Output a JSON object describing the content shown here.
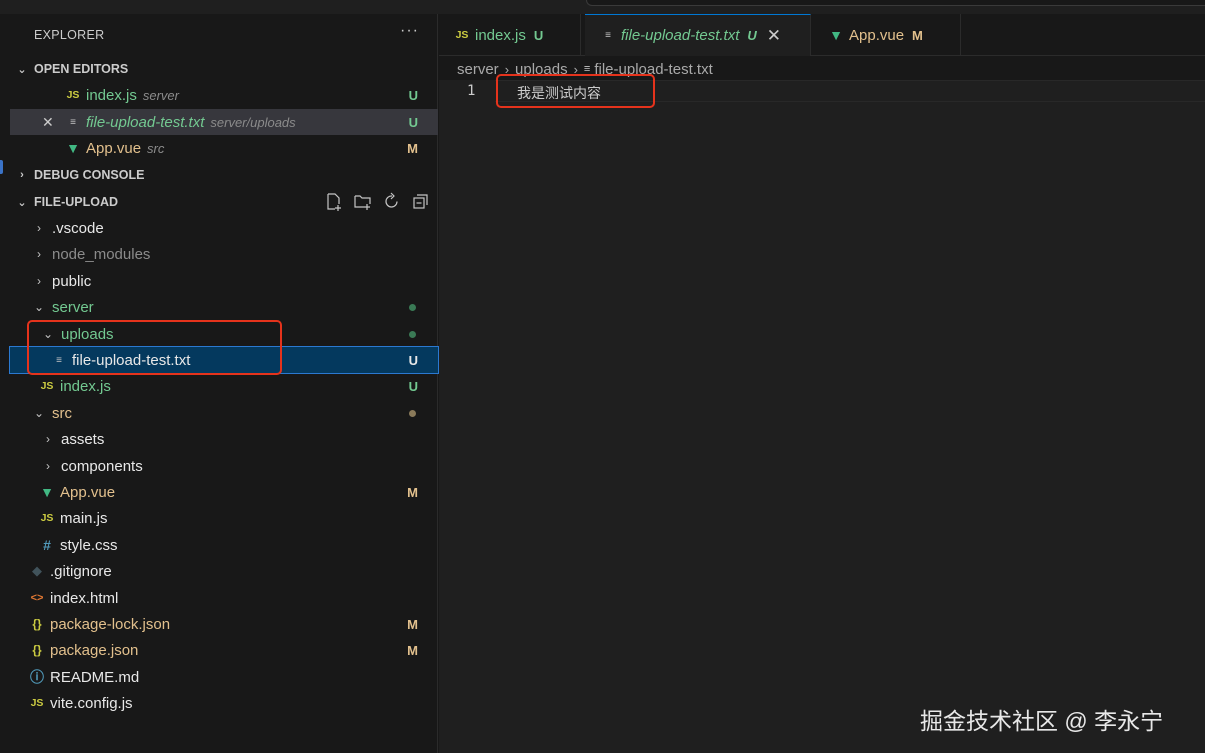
{
  "sidebar": {
    "title": "EXPLORER",
    "more": "···",
    "open_editors": {
      "header": "OPEN EDITORS",
      "items": [
        {
          "icon": "JS",
          "name": "index.js",
          "desc": "server",
          "status": "U"
        },
        {
          "icon": "≡",
          "name": "file-upload-test.txt",
          "desc": "server/uploads",
          "status": "U",
          "close": "✕"
        },
        {
          "icon": "▼",
          "name": "App.vue",
          "desc": "src",
          "status": "M"
        }
      ]
    },
    "debug_console": {
      "header": "DEBUG CONSOLE"
    },
    "project": {
      "header": "FILE-UPLOAD",
      "tree": [
        {
          "chev": "›",
          "name": ".vscode"
        },
        {
          "chev": "›",
          "name": "node_modules"
        },
        {
          "chev": "›",
          "name": "public"
        },
        {
          "chev": "⌄",
          "name": "server"
        },
        {
          "chev": "⌄",
          "name": "uploads"
        },
        {
          "icon": "≡",
          "name": "file-upload-test.txt",
          "status": "U"
        },
        {
          "icon": "JS",
          "name": "index.js",
          "status": "U"
        },
        {
          "chev": "⌄",
          "name": "src"
        },
        {
          "chev": "›",
          "name": "assets"
        },
        {
          "chev": "›",
          "name": "components"
        },
        {
          "icon": "▼",
          "name": "App.vue",
          "status": "M"
        },
        {
          "icon": "JS",
          "name": "main.js"
        },
        {
          "icon": "#",
          "name": "style.css"
        },
        {
          "icon": "◆",
          "name": ".gitignore"
        },
        {
          "icon": "<>",
          "name": "index.html"
        },
        {
          "icon": "{}",
          "name": "package-lock.json",
          "status": "M"
        },
        {
          "icon": "{}",
          "name": "package.json",
          "status": "M"
        },
        {
          "icon": "ⓘ",
          "name": "README.md"
        },
        {
          "icon": "JS",
          "name": "vite.config.js"
        }
      ]
    }
  },
  "tabs": [
    {
      "icon": "JS",
      "label": "index.js",
      "status": "U"
    },
    {
      "icon": "≡",
      "label": "file-upload-test.txt",
      "status": "U",
      "close": "✕"
    },
    {
      "icon": "▼",
      "label": "App.vue",
      "status": "M"
    }
  ],
  "breadcrumb": {
    "parts": [
      "server",
      "uploads",
      "file-upload-test.txt"
    ],
    "sep": "›",
    "file_icon": "≡"
  },
  "editor": {
    "line_number": "1",
    "line_text": "我是测试内容"
  },
  "watermark": "掘金技术社区 @ 李永宁",
  "colors": {
    "untracked": "#73c991",
    "modified": "#e2c08d",
    "selection": "#04395e",
    "annotation": "#e5331c"
  }
}
